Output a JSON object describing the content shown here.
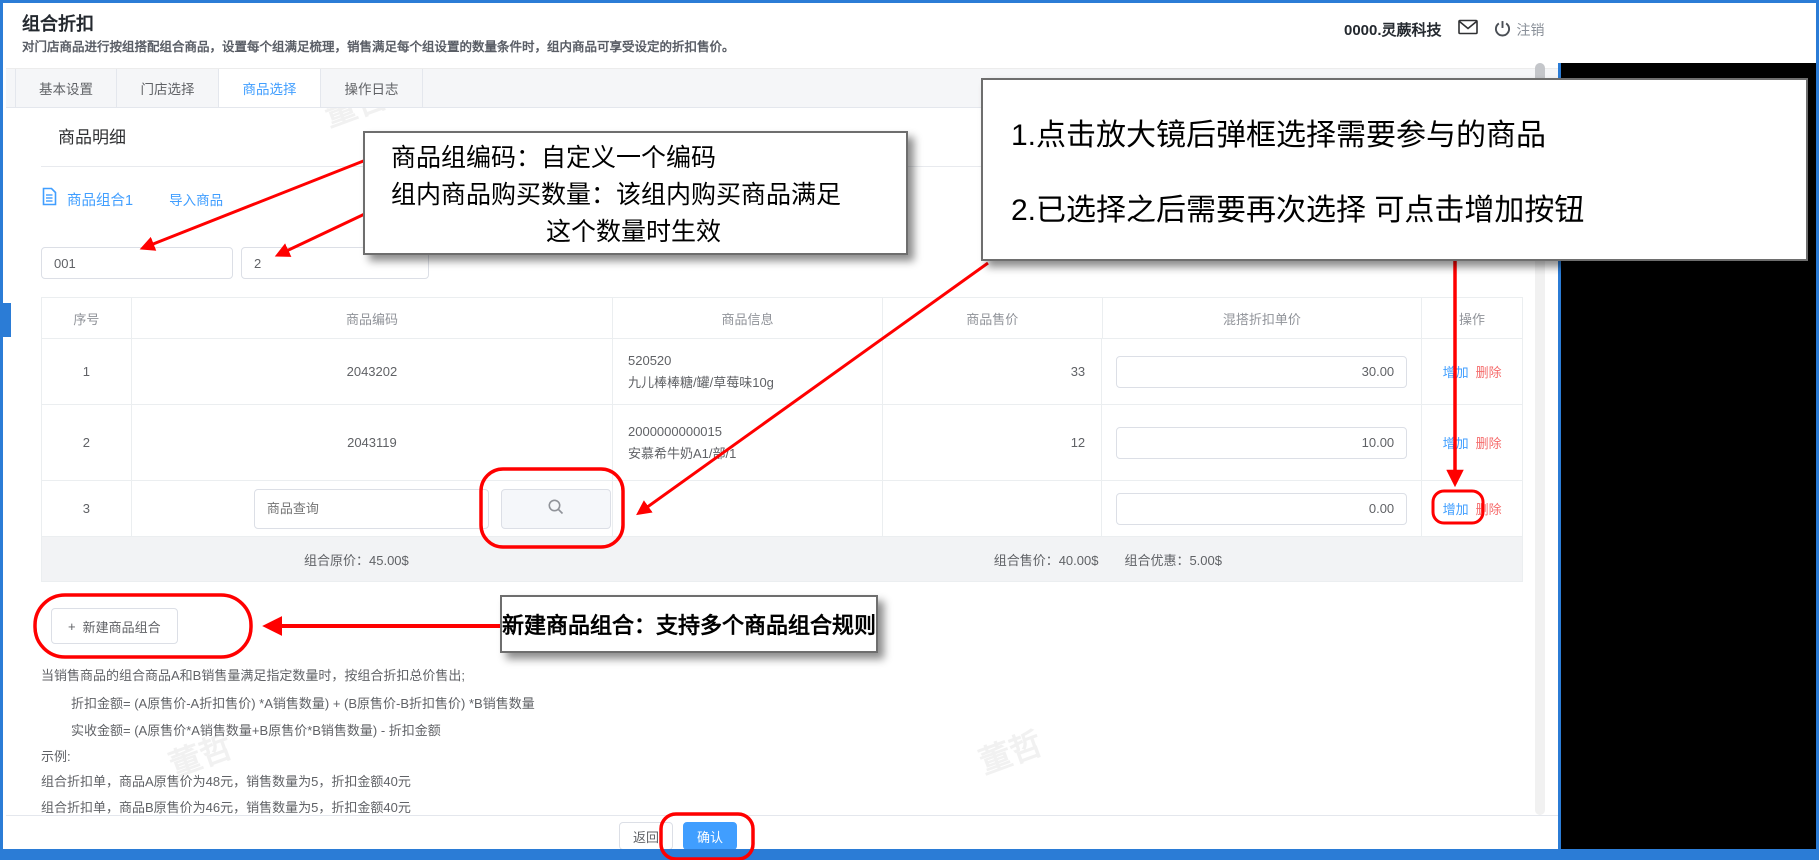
{
  "page": {
    "title": "组合折扣",
    "subtitle": "对门店商品进行按组搭配组合商品，设置每个组满足梳理，销售满足每个组设置的数量条件时，组内商品可享受设定的折扣售价。"
  },
  "user": {
    "account": "0000.灵蕨科技",
    "logout_label": "注销"
  },
  "icons": {
    "mail": "envelope-icon",
    "power": "power-icon",
    "document": "document-icon",
    "search": "magnifier-icon",
    "plus": "+"
  },
  "tabs": [
    {
      "label": "基本设置",
      "active": false
    },
    {
      "label": "门店选择",
      "active": false
    },
    {
      "label": "商品选择",
      "active": true
    },
    {
      "label": "操作日志",
      "active": false
    }
  ],
  "group": {
    "section_title": "商品明细",
    "name": "商品组合1",
    "import_label": "导入商品",
    "code_value": "001",
    "qty_value": "2"
  },
  "table": {
    "headers": [
      "序号",
      "商品编码",
      "商品信息",
      "商品售价",
      "混搭折扣单价",
      "操作"
    ],
    "rows": [
      {
        "seq": "1",
        "code": "2043202",
        "info1": "520520",
        "info2": "九儿棒棒糖/罐/草莓味10g",
        "price": "33",
        "discount": "30.00"
      },
      {
        "seq": "2",
        "code": "2043119",
        "info1": "2000000000015",
        "info2": "安慕希牛奶A1/部/1",
        "price": "12",
        "discount": "10.00"
      },
      {
        "seq": "3",
        "search_placeholder": "商品查询",
        "discount": "0.00"
      }
    ],
    "ops": {
      "add": "增加",
      "del": "删除"
    },
    "totals": {
      "original": "组合原价：45.00$",
      "sale": "组合售价：40.00$",
      "saving": "组合优惠：5.00$"
    }
  },
  "actions": {
    "new_group": "新建商品组合"
  },
  "notes": [
    "当销售商品的组合商品A和B销售量满足指定数量时，按组合折扣总价售出;",
    "折扣金额= (A原售价-A折扣售价) *A销售数量) + (B原售价-B折扣售价) *B销售数量",
    "实收金额= (A原售价*A销售数量+B原售价*B销售数量) - 折扣金额",
    "示例:",
    "组合折扣单，商品A原售价为48元，销售数量为5，折扣金额40元",
    "组合折扣单，商品B原售价为46元，销售数量为5，折扣金额40元"
  ],
  "footer": {
    "back": "返回",
    "confirm": "确认"
  },
  "callouts": {
    "c1": {
      "lines": [
        "商品组编码：自定义一个编码",
        "组内商品购买数量：该组内购买商品满足",
        "这个数量时生效"
      ]
    },
    "c2": {
      "lines": [
        "1.点击放大镜后弹框选择需要参与的商品",
        "2.已选择之后需要再次选择 可点击增加按钮"
      ]
    },
    "c3": {
      "text": "新建商品组合：支持多个商品组合规则"
    }
  },
  "watermark": {
    "text": "董哲"
  },
  "colors": {
    "accent": "#409eff",
    "danger": "#f56c6c",
    "annotation": "#ff0000",
    "frame": "#2b7cd6"
  }
}
